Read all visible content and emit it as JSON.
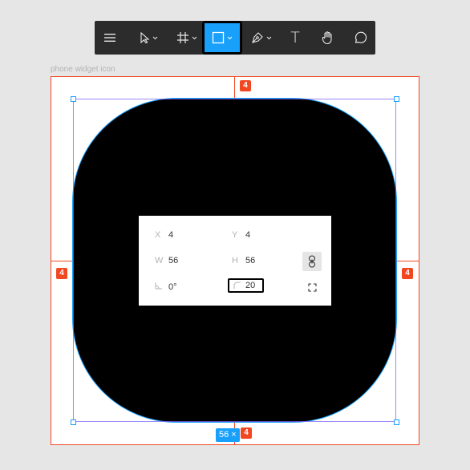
{
  "toolbar": {
    "tools": [
      {
        "id": "menu",
        "icon": "hamburger-menu-icon"
      },
      {
        "id": "move",
        "icon": "cursor-arrow-icon",
        "has_dropdown": true
      },
      {
        "id": "frame",
        "icon": "frame-hash-icon",
        "has_dropdown": true
      },
      {
        "id": "rectangle",
        "icon": "rectangle-icon",
        "has_dropdown": true,
        "active": true
      },
      {
        "id": "pen",
        "icon": "pen-nib-icon",
        "has_dropdown": true
      },
      {
        "id": "text",
        "icon": "text-icon",
        "label": "T"
      },
      {
        "id": "hand",
        "icon": "hand-icon"
      },
      {
        "id": "comment",
        "icon": "comment-bubble-icon"
      }
    ],
    "active_color": "#18a0fb"
  },
  "frame": {
    "label": "phone widget icon"
  },
  "spacing": {
    "top": "4",
    "left": "4",
    "right": "4",
    "bottom": "4"
  },
  "selection": {
    "size_label": "56",
    "size_suffix": "×"
  },
  "properties": {
    "x_label": "X",
    "x_value": "4",
    "y_label": "Y",
    "y_value": "4",
    "w_label": "W",
    "w_value": "56",
    "h_label": "H",
    "h_value": "56",
    "rotation_value": "0°",
    "radius_value": "20",
    "constrain_proportions_icon": "link-icon",
    "independent_corners_icon": "corners-icon",
    "rotation_icon": "rotation-angle-icon",
    "radius_icon": "corner-radius-icon"
  },
  "colors": {
    "accent": "#18a0fb",
    "measure": "#f24822",
    "shape_fill": "#000000",
    "toolbar_bg": "#2c2c2c"
  }
}
